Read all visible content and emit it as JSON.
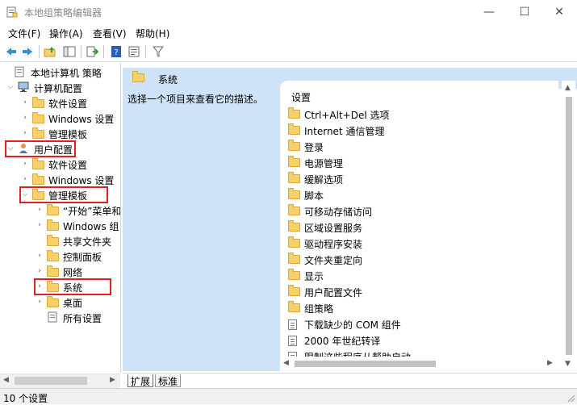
{
  "window": {
    "title": "本地组策略编辑器",
    "controls": [
      "—",
      "☐",
      "✕"
    ]
  },
  "menu": [
    "文件(F)",
    "操作(A)",
    "查看(V)",
    "帮助(H)"
  ],
  "toolbar": {
    "icons": [
      "back-arrow-icon",
      "forward-arrow-icon",
      "folder-up-icon",
      "show-hide-tree-icon",
      "export-list-icon",
      "help-icon",
      "properties-icon",
      "filter-icon"
    ]
  },
  "tree": [
    {
      "label": "本地计算机 策略",
      "level": 0,
      "expanded": true,
      "icon": "policy"
    },
    {
      "label": "计算机配置",
      "level": 1,
      "expanded": true,
      "icon": "computer"
    },
    {
      "label": "软件设置",
      "level": 2,
      "expanded": false,
      "icon": "folder"
    },
    {
      "label": "Windows 设置",
      "level": 2,
      "expanded": false,
      "icon": "folder"
    },
    {
      "label": "管理模板",
      "level": 2,
      "expanded": false,
      "icon": "folder"
    },
    {
      "label": "用户配置",
      "level": 1,
      "expanded": true,
      "icon": "user",
      "highlight": true
    },
    {
      "label": "软件设置",
      "level": 2,
      "expanded": false,
      "icon": "folder"
    },
    {
      "label": "Windows 设置",
      "level": 2,
      "expanded": false,
      "icon": "folder"
    },
    {
      "label": "管理模板",
      "level": 2,
      "expanded": true,
      "icon": "folder",
      "highlight": true
    },
    {
      "label": "“开始”菜单和",
      "level": 3,
      "expanded": false,
      "icon": "folder"
    },
    {
      "label": "Windows 组",
      "level": 3,
      "expanded": false,
      "icon": "folder"
    },
    {
      "label": "共享文件夹",
      "level": 3,
      "expanded": null,
      "icon": "folder"
    },
    {
      "label": "控制面板",
      "level": 3,
      "expanded": false,
      "icon": "folder"
    },
    {
      "label": "网络",
      "level": 3,
      "expanded": false,
      "icon": "folder"
    },
    {
      "label": "系统",
      "level": 3,
      "expanded": false,
      "icon": "folder",
      "highlight": true,
      "selected": true
    },
    {
      "label": "桌面",
      "level": 3,
      "expanded": false,
      "icon": "folder"
    },
    {
      "label": "所有设置",
      "level": 3,
      "expanded": null,
      "icon": "allsettings"
    }
  ],
  "right": {
    "header_title": "系统",
    "description": "选择一个项目来查看它的描述。",
    "column_header": "设置",
    "items": [
      {
        "label": "Ctrl+Alt+Del 选项",
        "icon": "folder"
      },
      {
        "label": "Internet 通信管理",
        "icon": "folder"
      },
      {
        "label": "登录",
        "icon": "folder"
      },
      {
        "label": "电源管理",
        "icon": "folder"
      },
      {
        "label": "缓解选项",
        "icon": "folder"
      },
      {
        "label": "脚本",
        "icon": "folder"
      },
      {
        "label": "可移动存储访问",
        "icon": "folder"
      },
      {
        "label": "区域设置服务",
        "icon": "folder"
      },
      {
        "label": "驱动程序安装",
        "icon": "folder"
      },
      {
        "label": "文件夹重定向",
        "icon": "folder"
      },
      {
        "label": "显示",
        "icon": "folder"
      },
      {
        "label": "用户配置文件",
        "icon": "folder"
      },
      {
        "label": "组策略",
        "icon": "folder"
      },
      {
        "label": "下载缺少的 COM 组件",
        "icon": "doc"
      },
      {
        "label": "2000 年世纪转译",
        "icon": "doc"
      },
      {
        "label": "限制这些程序从帮助启动",
        "icon": "doc"
      }
    ],
    "tabs": [
      "扩展",
      "标准"
    ]
  },
  "status": {
    "text": "10 个设置"
  },
  "colors": {
    "header_bg": "#cfe3f8",
    "highlight": "#e02020",
    "folder": "#f6d06b"
  }
}
